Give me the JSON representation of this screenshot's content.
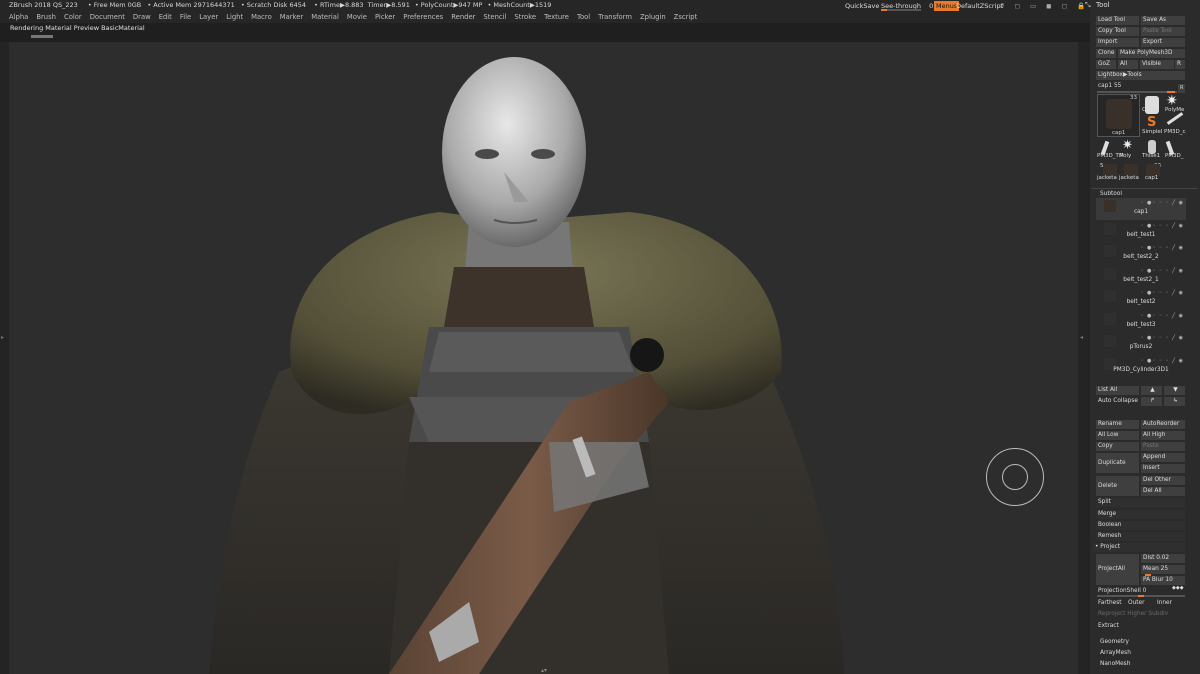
{
  "app": {
    "title": "ZBrush 2018 QS_223",
    "free_mem": "• Free Mem 0GB",
    "active_mem": "• Active Mem 2971644371",
    "scratch_disk": "• Scratch Disk 6454",
    "rtime": "• RTime▶8.883",
    "timer": "Timer▶8.591",
    "polycount": "• PolyCount▶947 MP",
    "meshcount": "• MeshCount▶1519"
  },
  "menu": [
    "Alpha",
    "Brush",
    "Color",
    "Document",
    "Draw",
    "Edit",
    "File",
    "Layer",
    "Light",
    "Macro",
    "Marker",
    "Material",
    "Movie",
    "Picker",
    "Preferences",
    "Render",
    "Stencil",
    "Stroke",
    "Texture",
    "Tool",
    "Transform",
    "Zplugin",
    "Zscript"
  ],
  "top_right": {
    "quicksave": "QuickSave",
    "see_through_label": "See-through",
    "see_through_value": "0",
    "menus": "Menus",
    "zscript": "DefaultZScript"
  },
  "status": "Rendering Material Preview BasicMaterial",
  "palette": {
    "title": "Tool",
    "load_tool": "Load Tool",
    "save_as": "Save As",
    "copy_tool": "Copy Tool",
    "paste_tool": "Paste Tool",
    "import": "Import",
    "export": "Export",
    "clone": "Clone",
    "make_polymesh": "Make PolyMesh3D",
    "goz": "GoZ",
    "all": "All",
    "visible": "Visible",
    "r": "R",
    "lightbox_tools": "Lightbox▶Tools",
    "current_tool_label": "cap1",
    "current_tool_value": "55",
    "tool_thumb_labels": {
      "cap1_big": "cap1",
      "cap1_count": "33",
      "cylinder": "Cylind",
      "polymesh": "PolyMe",
      "simple": "SimpleI",
      "pm3d": "PM3D_c",
      "pm3d_tm": "PM3D_TM",
      "poly": "Poly",
      "t1": "Thise1",
      "pm3d2": "PM3D_",
      "count5": "5",
      "jacketa": "jacketa",
      "jacketb": "jacketa",
      "cap1b": "cap1",
      "count3": "33"
    },
    "subtool_header": "Subtool",
    "subtools": [
      "cap1",
      "belt_test1",
      "belt_test2_2",
      "belt_test2_1",
      "belt_test2",
      "belt_test3",
      "pTorus2",
      "PM3D_Cylinder3D1"
    ],
    "list_all": "List All",
    "auto_collapse": "Auto Collapse",
    "rename": "Rename",
    "auto_reorder": "AutoReorder",
    "all_low": "All Low",
    "all_high": "All High",
    "copy": "Copy",
    "paste": "Paste",
    "duplicate": "Duplicate",
    "append": "Append",
    "insert": "Insert",
    "delete": "Delete",
    "del_other": "Del Other",
    "del_all": "Del All",
    "split": "Split",
    "merge": "Merge",
    "boolean": "Boolean",
    "remesh": "Remesh",
    "project": "• Project",
    "project_all": "ProjectAll",
    "dist": "Dist 0.02",
    "mean": "Mean 25",
    "pa_blur": "PA Blur 10",
    "projection_shell": "ProjectionShell 0",
    "farthest": "Farthest",
    "outer": "Outer",
    "inner": "Inner",
    "reproject": "Reproject Higher Subdiv",
    "extract": "Extract",
    "geometry": "Geometry",
    "arraymesh": "ArrayMesh",
    "nanomesh": "NanoMesh"
  },
  "colors": {
    "accent": "#e87a2a",
    "menus_bg": "#e87a2a",
    "canvas_bg": "#2d2d2d",
    "button_bg": "#3f3f3f"
  }
}
